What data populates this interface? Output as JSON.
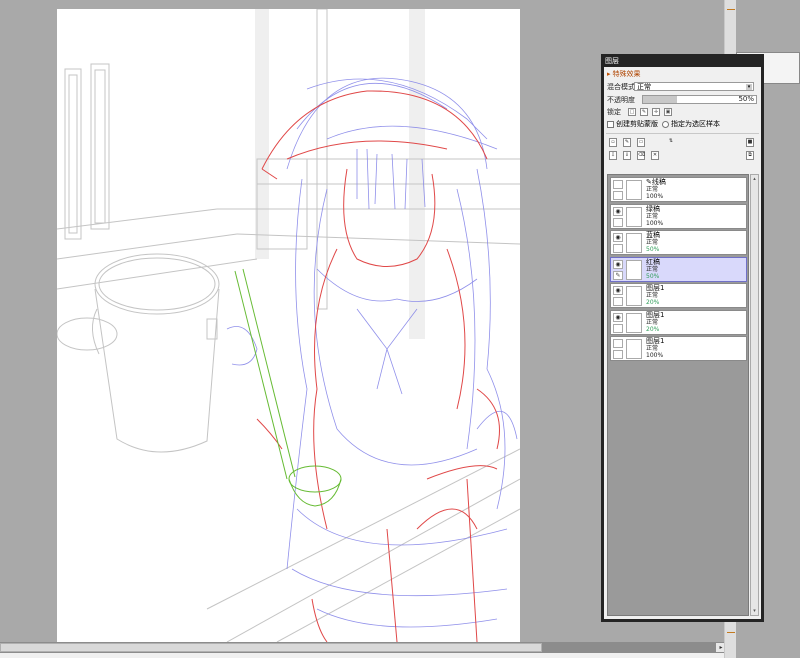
{
  "layer_panel": {
    "title": "图层",
    "effects_label": "特殊效果",
    "blend_mode_label": "混合模式",
    "blend_mode_value": "正常",
    "opacity_label": "不透明度",
    "opacity_value": "50%",
    "opacity_fraction": 0.5,
    "lock_label": "锁定",
    "clipping_label": "创建剪贴蒙版",
    "sample_source_label": "指定为选区样本",
    "layers": [
      {
        "name": "线稿",
        "mode": "正常",
        "opacity": "100%",
        "visible": false,
        "selected": false,
        "folder": true
      },
      {
        "name": "绿稿",
        "mode": "正常",
        "opacity": "100%",
        "visible": true,
        "selected": false,
        "folder": false
      },
      {
        "name": "蓝稿",
        "mode": "正常",
        "opacity": "50%",
        "visible": true,
        "selected": false,
        "folder": false
      },
      {
        "name": "红稿",
        "mode": "正常",
        "opacity": "50%",
        "visible": true,
        "selected": true,
        "folder": false
      },
      {
        "name": "图层1",
        "mode": "正常",
        "opacity": "20%",
        "visible": true,
        "selected": false,
        "folder": false
      },
      {
        "name": "图层1",
        "mode": "正常",
        "opacity": "20%",
        "visible": true,
        "selected": false,
        "folder": false
      },
      {
        "name": "图层1",
        "mode": "正常",
        "opacity": "100%",
        "visible": false,
        "selected": false,
        "folder": false
      }
    ]
  },
  "colors": {
    "canvas_bg": "#ffffff",
    "workspace_bg": "#a9a9a9",
    "panel_frame": "#242424",
    "selected_layer": "#d9d9fb",
    "effects_text": "#b04500",
    "opacity_low_text": "#2f9e5a",
    "sketch_red": "#e04848",
    "sketch_blue": "#7c7ce8",
    "sketch_green": "#66bb33",
    "sketch_grey": "#b8b8b8"
  }
}
